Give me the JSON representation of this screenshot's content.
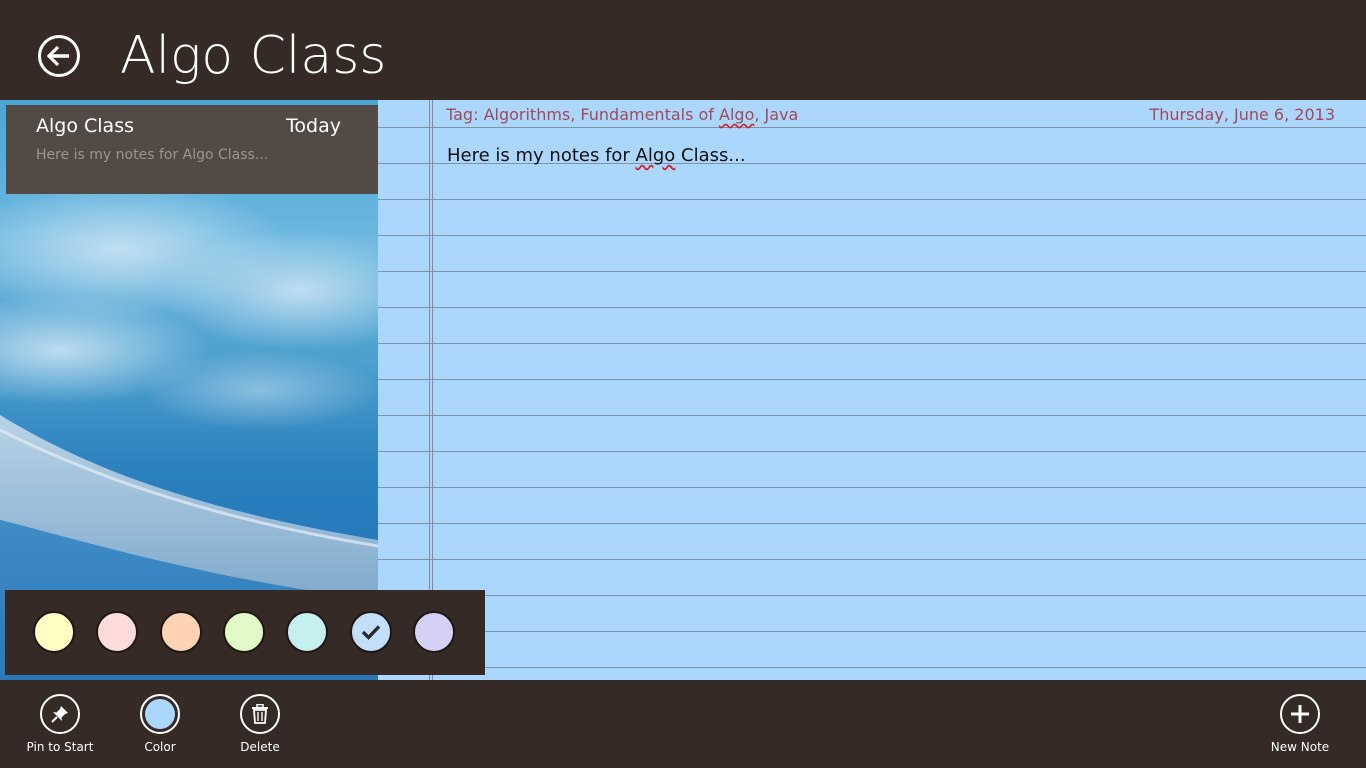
{
  "header": {
    "title": "Algo Class",
    "back_icon": "back-arrow-icon"
  },
  "note_list": {
    "items": [
      {
        "title": "Algo Class",
        "date": "Today",
        "preview": "Here is my notes for Algo Class..."
      }
    ]
  },
  "note": {
    "tag_prefix": "Tag: Algorithms, Fundamentals of ",
    "tag_spell": "Algo",
    "tag_suffix": ", Java",
    "date": "Thursday, June 6, 2013",
    "body_prefix": "Here is my notes for ",
    "body_spell": "Algo",
    "body_suffix": " Class...",
    "paper_color": "#acd7fc"
  },
  "color_picker": {
    "swatches": [
      {
        "color": "#fffcc4",
        "selected": false
      },
      {
        "color": "#ffdcdc",
        "selected": false
      },
      {
        "color": "#ffd3b3",
        "selected": false
      },
      {
        "color": "#e2f9c8",
        "selected": false
      },
      {
        "color": "#c4f1ef",
        "selected": false
      },
      {
        "color": "#c2def8",
        "selected": true
      },
      {
        "color": "#d4d0f6",
        "selected": false
      }
    ]
  },
  "appbar": {
    "pin_label": "Pin to Start",
    "color_label": "Color",
    "delete_label": "Delete",
    "new_note_label": "New Note",
    "color_value": "#acd7fc"
  }
}
